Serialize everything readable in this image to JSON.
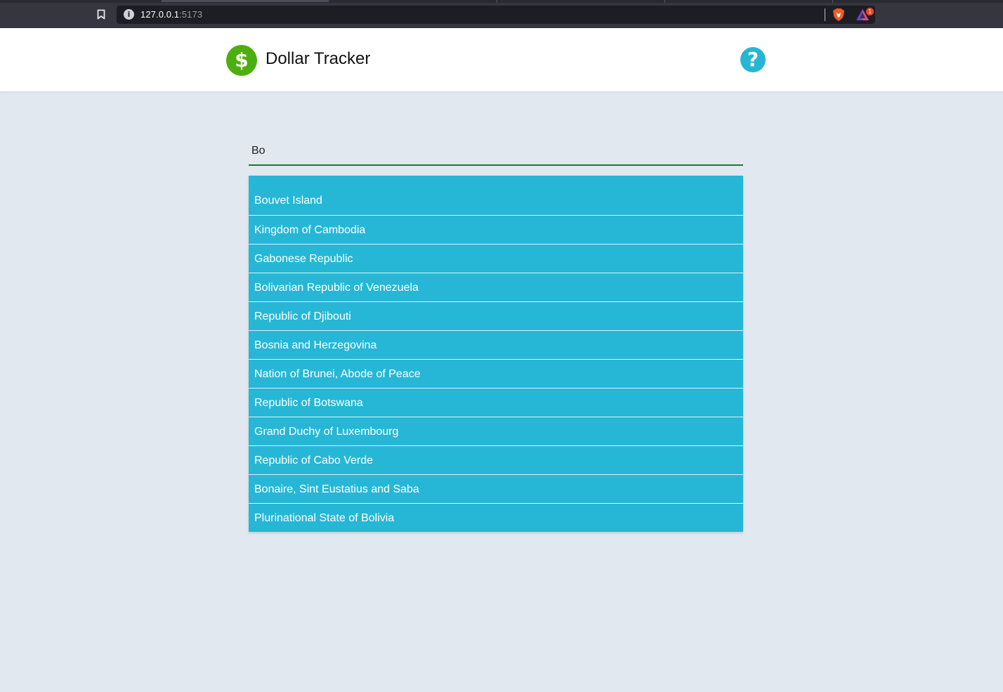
{
  "browser": {
    "url_host": "127.0.0.1",
    "url_port": ":5173",
    "info_icon": "i",
    "rewards_badge": "1"
  },
  "header": {
    "logo_symbol": "$",
    "title": "Dollar Tracker",
    "help_symbol": "?"
  },
  "search": {
    "value": "Bo",
    "placeholder": ""
  },
  "results": [
    "Bouvet Island",
    "Kingdom of Cambodia",
    "Gabonese Republic",
    "Bolivarian Republic of Venezuela",
    "Republic of Djibouti",
    "Bosnia and Herzegovina",
    "Nation of Brunei, Abode of Peace",
    "Republic of Botswana",
    "Grand Duchy of Luxembourg",
    "Republic of Cabo Verde",
    "Bonaire, Sint Eustatius and Saba",
    "Plurinational State of Bolivia"
  ],
  "colors": {
    "page_bg": "#e1e8f0",
    "logo_green": "#4caf0f",
    "accent_cyan": "#26b7d6",
    "search_underline": "#1e7a2e"
  }
}
